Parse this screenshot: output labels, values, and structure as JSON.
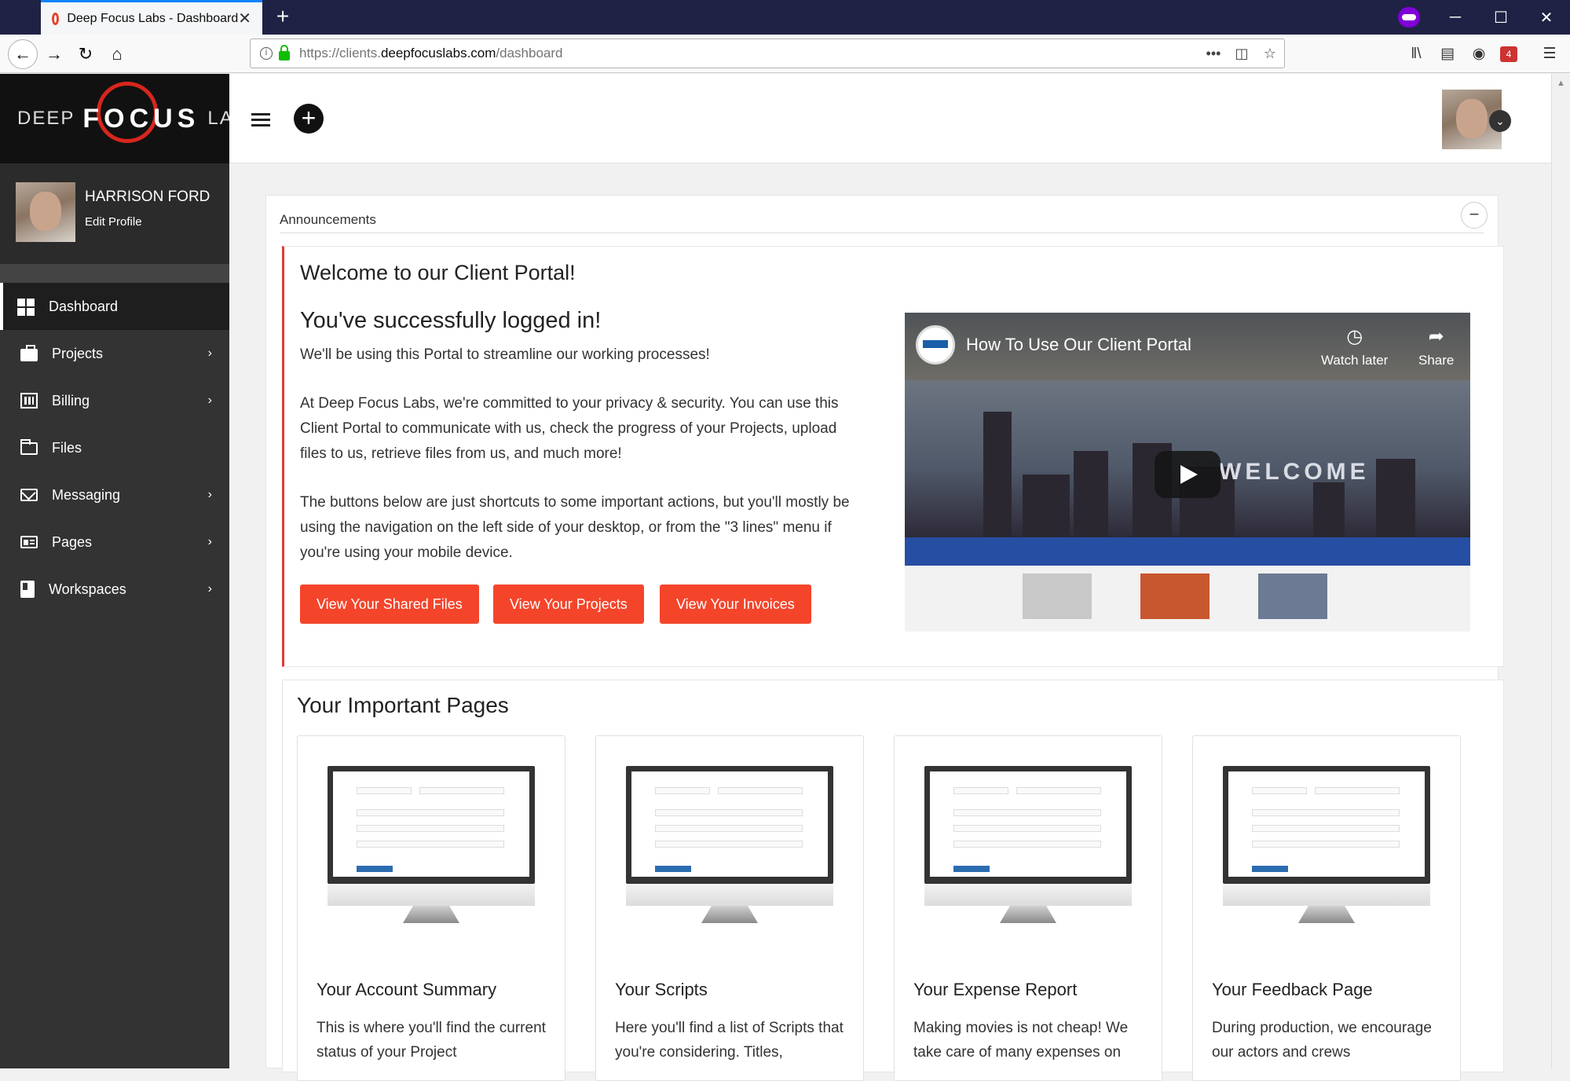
{
  "browser": {
    "tab_title": "Deep Focus Labs - Dashboard",
    "url_prefix": "https://clients.",
    "url_domain": "deepfocuslabs.com",
    "url_path": "/dashboard",
    "url_more": "•••",
    "addon_badge": "4"
  },
  "brand": {
    "left": "DEEP",
    "middle": "FOCUS",
    "right": "LABS"
  },
  "profile": {
    "name": "HARRISON FORD",
    "edit_label": "Edit Profile"
  },
  "sidebar": {
    "items": [
      {
        "label": "Dashboard"
      },
      {
        "label": "Projects"
      },
      {
        "label": "Billing"
      },
      {
        "label": "Files"
      },
      {
        "label": "Messaging"
      },
      {
        "label": "Pages"
      },
      {
        "label": "Workspaces"
      }
    ]
  },
  "announcements": {
    "header": "Announcements",
    "title": "Welcome to our Client Portal!",
    "subtitle": "You've successfully logged in!",
    "para1": "We'll be using this Portal to streamline our working processes!",
    "para2": "At Deep Focus Labs, we're committed to your privacy & security. You can use this Client Portal to communicate with us, check the progress of your Projects, upload files to us, retrieve files from us, and much more!",
    "para3": "The buttons below are just shortcuts to some important actions, but you'll mostly be using the navigation on the left side of your desktop, or from the \"3 lines\" menu if you're using your mobile device.",
    "buttons": [
      "View Your Shared Files",
      "View Your Projects",
      "View Your Invoices"
    ]
  },
  "video": {
    "title": "How To Use Our Client Portal",
    "watch_later": "Watch later",
    "share": "Share",
    "welcome_text": "WELCOME"
  },
  "important_pages": {
    "heading": "Your Important Pages",
    "cards": [
      {
        "title": "Your Account Summary",
        "desc": "This is where you'll find the current status of your Project"
      },
      {
        "title": "Your Scripts",
        "desc": "Here you'll find a list of Scripts that you're considering. Titles,"
      },
      {
        "title": "Your Expense Report",
        "desc": "Making movies is not cheap! We take care of many expenses on"
      },
      {
        "title": "Your Feedback Page",
        "desc": "During production, we encourage our actors and crews"
      }
    ]
  },
  "colors": {
    "accent_red": "#f4452b",
    "sidebar_bg": "#333333",
    "tab_bar": "#1f2245"
  }
}
